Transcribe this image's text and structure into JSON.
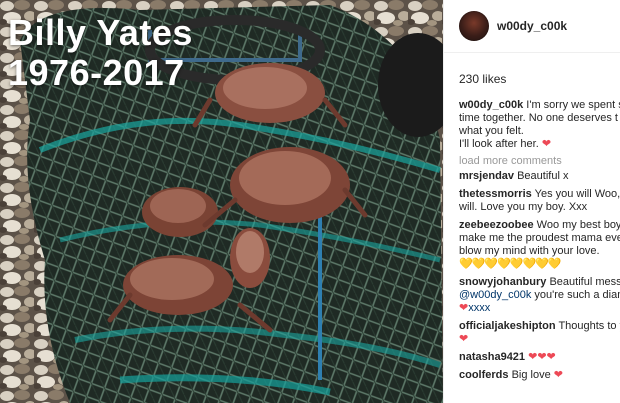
{
  "photo": {
    "overlay_name": "Billy Yates",
    "overlay_years": "1976-2017"
  },
  "post": {
    "username": "w00dy_c00k",
    "likes": "230 likes",
    "caption": {
      "user": "w00dy_c00k",
      "lines": [
        "I'm sorry we spent so",
        "time together. No one deserves t",
        "what you felt.",
        "I'll look after her."
      ],
      "heart": "❤"
    },
    "load_more": "load more comments",
    "comments": [
      {
        "user": "mrsjendav",
        "lines": [
          "Beautiful x"
        ]
      },
      {
        "user": "thetessmorris",
        "lines": [
          "Yes you will Woo, y",
          "will. Love you my boy. Xxx"
        ]
      },
      {
        "user": "zeebeezoobee",
        "lines": [
          "Woo my best boy",
          "make me the proudest mama eve",
          "blow my mind with your love."
        ],
        "emoji": "💛💛💛💛💛💛💛💛"
      },
      {
        "user": "snowyjohanbury",
        "lines": [
          "Beautiful messa"
        ],
        "mention": "@w00dy_c00k",
        "mention_text": "you're such a diam",
        "mention2": "@",
        "end": "xxxx"
      },
      {
        "user": "officialjakeshipton",
        "lines": [
          "Thoughts to y"
        ],
        "heart": "❤"
      },
      {
        "user": "natasha9421",
        "hearts": "❤❤❤"
      },
      {
        "user": "coolferds",
        "lines": [
          "Big love"
        ],
        "heart": "❤"
      }
    ]
  },
  "colors": {
    "text": "#262626",
    "link": "#003569",
    "heart": "#ed4956",
    "muted": "#999999"
  }
}
